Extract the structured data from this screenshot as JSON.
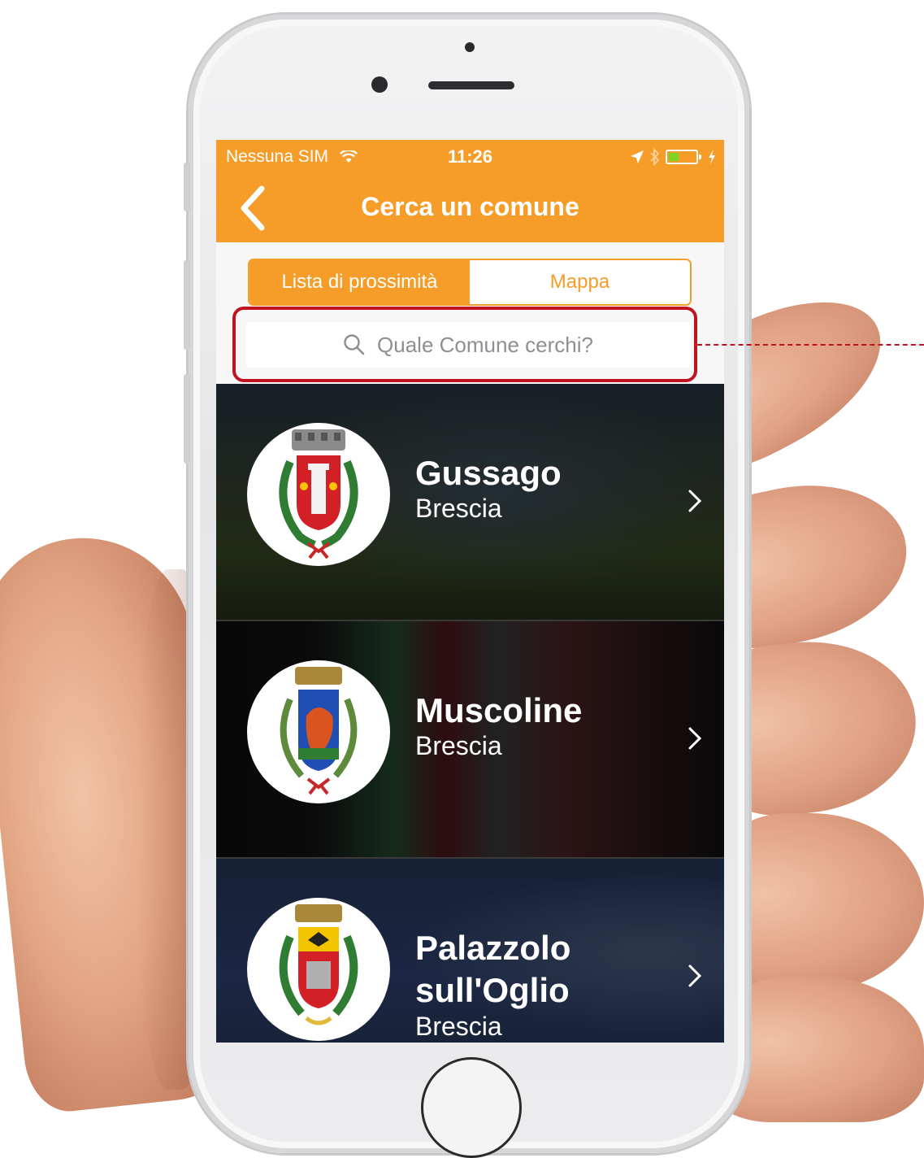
{
  "status_bar": {
    "carrier": "Nessuna SIM",
    "time": "11:26"
  },
  "nav": {
    "title": "Cerca un comune"
  },
  "segments": {
    "list_label": "Lista di prossimità",
    "map_label": "Mappa"
  },
  "search": {
    "placeholder": "Quale Comune cerchi?"
  },
  "list": [
    {
      "name": "Gussago",
      "province": "Brescia"
    },
    {
      "name_line1": "Muscoline",
      "province": "Brescia"
    },
    {
      "name_line1": "Palazzolo",
      "name_line2": "sull'Oglio",
      "province": "Brescia"
    }
  ],
  "colors": {
    "accent": "#f59d28",
    "highlight": "#c1121f"
  }
}
